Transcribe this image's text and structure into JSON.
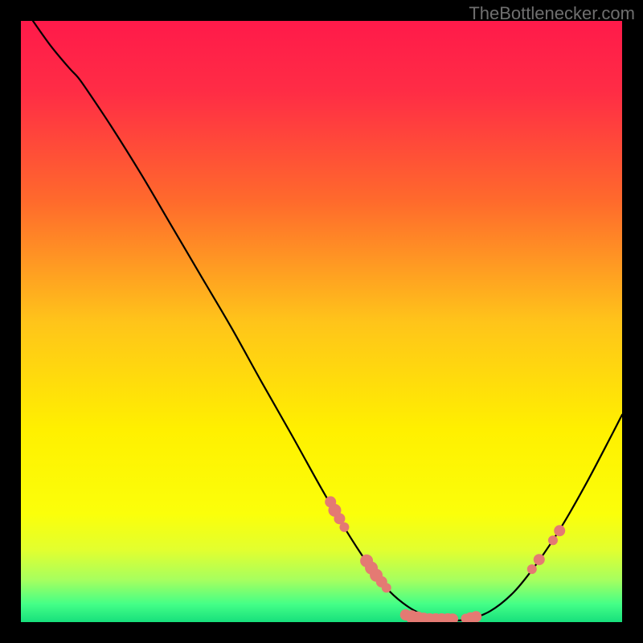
{
  "watermark": "TheBottlenecker.com",
  "colors": {
    "bg_black": "#000000",
    "curve": "#000000",
    "marker": "#e47a73",
    "watermark_text": "#6f6f6f"
  },
  "chart_data": {
    "type": "line",
    "title": "",
    "xlabel": "",
    "ylabel": "",
    "xlim": [
      0,
      1
    ],
    "ylim": [
      0,
      1
    ],
    "gradient_stops": [
      {
        "offset": 0.0,
        "color": "#ff1a4a"
      },
      {
        "offset": 0.12,
        "color": "#ff2d45"
      },
      {
        "offset": 0.3,
        "color": "#ff6a2c"
      },
      {
        "offset": 0.5,
        "color": "#ffc41a"
      },
      {
        "offset": 0.68,
        "color": "#fff000"
      },
      {
        "offset": 0.82,
        "color": "#fbff0a"
      },
      {
        "offset": 0.88,
        "color": "#e2ff2f"
      },
      {
        "offset": 0.93,
        "color": "#a6ff5f"
      },
      {
        "offset": 0.97,
        "color": "#44ff87"
      },
      {
        "offset": 1.0,
        "color": "#17e07c"
      }
    ],
    "curve": [
      {
        "x": 0.02,
        "y": 1.0
      },
      {
        "x": 0.05,
        "y": 0.958
      },
      {
        "x": 0.08,
        "y": 0.922
      },
      {
        "x": 0.095,
        "y": 0.906
      },
      {
        "x": 0.11,
        "y": 0.885
      },
      {
        "x": 0.15,
        "y": 0.825
      },
      {
        "x": 0.2,
        "y": 0.745
      },
      {
        "x": 0.25,
        "y": 0.66
      },
      {
        "x": 0.3,
        "y": 0.575
      },
      {
        "x": 0.35,
        "y": 0.49
      },
      {
        "x": 0.4,
        "y": 0.4
      },
      {
        "x": 0.45,
        "y": 0.312
      },
      {
        "x": 0.5,
        "y": 0.222
      },
      {
        "x": 0.54,
        "y": 0.154
      },
      {
        "x": 0.575,
        "y": 0.1
      },
      {
        "x": 0.605,
        "y": 0.06
      },
      {
        "x": 0.635,
        "y": 0.032
      },
      {
        "x": 0.665,
        "y": 0.014
      },
      {
        "x": 0.7,
        "y": 0.004
      },
      {
        "x": 0.74,
        "y": 0.004
      },
      {
        "x": 0.78,
        "y": 0.018
      },
      {
        "x": 0.82,
        "y": 0.05
      },
      {
        "x": 0.86,
        "y": 0.1
      },
      {
        "x": 0.9,
        "y": 0.16
      },
      {
        "x": 0.94,
        "y": 0.23
      },
      {
        "x": 0.98,
        "y": 0.306
      },
      {
        "x": 1.0,
        "y": 0.345
      }
    ],
    "markers": [
      {
        "x": 0.515,
        "y": 0.2,
        "s": 7
      },
      {
        "x": 0.522,
        "y": 0.186,
        "s": 8
      },
      {
        "x": 0.53,
        "y": 0.172,
        "s": 7
      },
      {
        "x": 0.538,
        "y": 0.158,
        "s": 6
      },
      {
        "x": 0.575,
        "y": 0.102,
        "s": 8
      },
      {
        "x": 0.583,
        "y": 0.09,
        "s": 8
      },
      {
        "x": 0.591,
        "y": 0.078,
        "s": 8
      },
      {
        "x": 0.6,
        "y": 0.067,
        "s": 7
      },
      {
        "x": 0.608,
        "y": 0.057,
        "s": 6
      },
      {
        "x": 0.64,
        "y": 0.012,
        "s": 7
      },
      {
        "x": 0.65,
        "y": 0.009,
        "s": 8
      },
      {
        "x": 0.66,
        "y": 0.007,
        "s": 8
      },
      {
        "x": 0.67,
        "y": 0.005,
        "s": 8
      },
      {
        "x": 0.68,
        "y": 0.004,
        "s": 8
      },
      {
        "x": 0.69,
        "y": 0.004,
        "s": 8
      },
      {
        "x": 0.7,
        "y": 0.004,
        "s": 8
      },
      {
        "x": 0.71,
        "y": 0.004,
        "s": 8
      },
      {
        "x": 0.718,
        "y": 0.005,
        "s": 7
      },
      {
        "x": 0.74,
        "y": 0.006,
        "s": 6
      },
      {
        "x": 0.748,
        "y": 0.007,
        "s": 7
      },
      {
        "x": 0.757,
        "y": 0.009,
        "s": 7
      },
      {
        "x": 0.85,
        "y": 0.088,
        "s": 6
      },
      {
        "x": 0.862,
        "y": 0.104,
        "s": 7
      },
      {
        "x": 0.885,
        "y": 0.136,
        "s": 6
      },
      {
        "x": 0.896,
        "y": 0.152,
        "s": 7
      }
    ]
  }
}
